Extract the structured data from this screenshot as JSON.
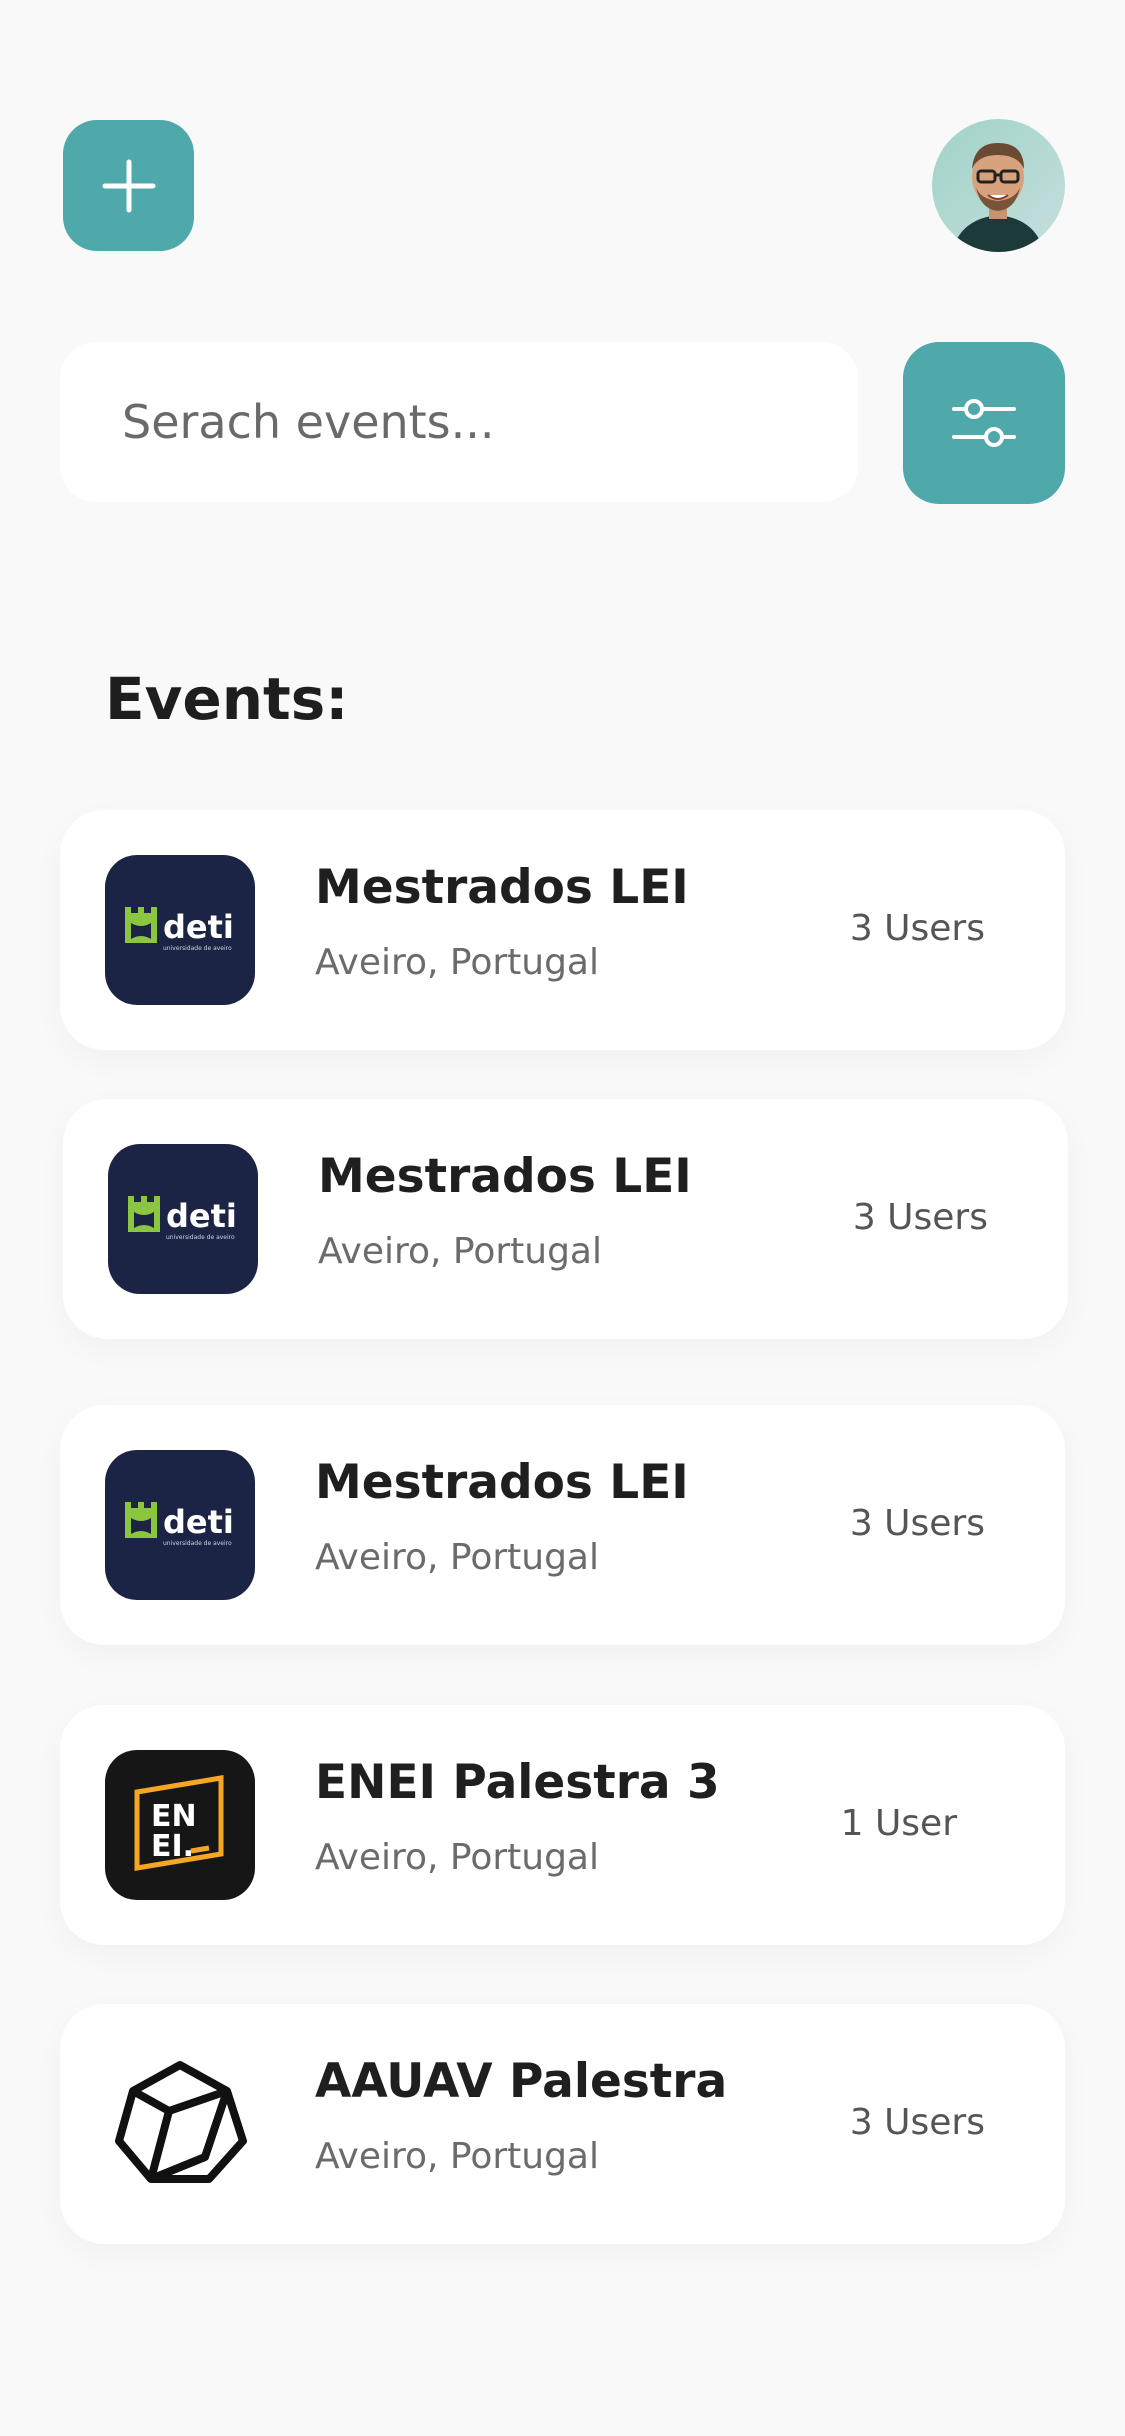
{
  "header": {
    "add_icon": "plus-icon",
    "avatar_alt": "user avatar"
  },
  "search": {
    "placeholder": "Serach events...",
    "value": "",
    "filter_icon": "sliders-icon"
  },
  "section": {
    "title": "Events:"
  },
  "events": [
    {
      "title": "Mestrados LEI",
      "location": "Aveiro, Portugal",
      "users": "3 Users",
      "logo": "deti-logo"
    },
    {
      "title": "Mestrados LEI",
      "location": "Aveiro, Portugal",
      "users": "3 Users",
      "logo": "deti-logo"
    },
    {
      "title": "Mestrados LEI",
      "location": "Aveiro, Portugal",
      "users": "3 Users",
      "logo": "deti-logo"
    },
    {
      "title": "ENEI Palestra 3",
      "location": "Aveiro, Portugal",
      "users": "1 User",
      "logo": "enei-logo"
    },
    {
      "title": "AAUAV Palestra",
      "location": "Aveiro, Portugal",
      "users": "3 Users",
      "logo": "aauav-logo"
    }
  ],
  "logos": {
    "deti_text": "deti",
    "deti_sub": "universidade de aveiro",
    "enei_line1": "EN",
    "enei_line2": "EI."
  },
  "colors": {
    "accent": "#4fa8aa",
    "deti_bg": "#1b2444",
    "deti_green": "#8cc63f",
    "enei_bg": "#161616",
    "enei_orange": "#f5a623"
  }
}
